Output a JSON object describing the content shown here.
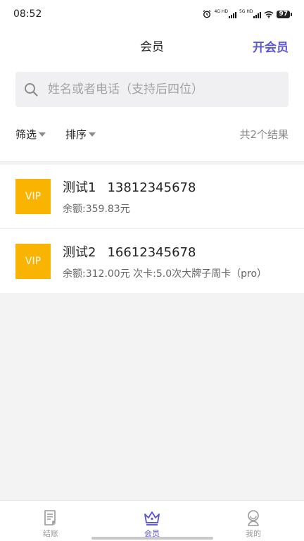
{
  "status_bar": {
    "time": "08:52",
    "network_1": "4G HD",
    "network_2": "5G HD",
    "battery": "97"
  },
  "header": {
    "title": "会员",
    "action_label": "开会员",
    "accent_color": "#5b57d6"
  },
  "search": {
    "placeholder": "姓名或者电话（支持后四位）",
    "value": ""
  },
  "filter_bar": {
    "filter_label": "筛选",
    "sort_label": "排序",
    "result_count": "共2个结果"
  },
  "members": [
    {
      "badge": "VIP",
      "name": "测试1",
      "phone": "13812345678",
      "detail": "余额:359.83元"
    },
    {
      "badge": "VIP",
      "name": "测试2",
      "phone": "16612345678",
      "detail": "余额:312.00元 次卡:5.0次大牌子周卡（pro）"
    }
  ],
  "tabs": [
    {
      "label": "结账",
      "icon": "receipt-icon"
    },
    {
      "label": "会员",
      "icon": "crown-icon"
    },
    {
      "label": "我的",
      "icon": "user-icon"
    }
  ]
}
